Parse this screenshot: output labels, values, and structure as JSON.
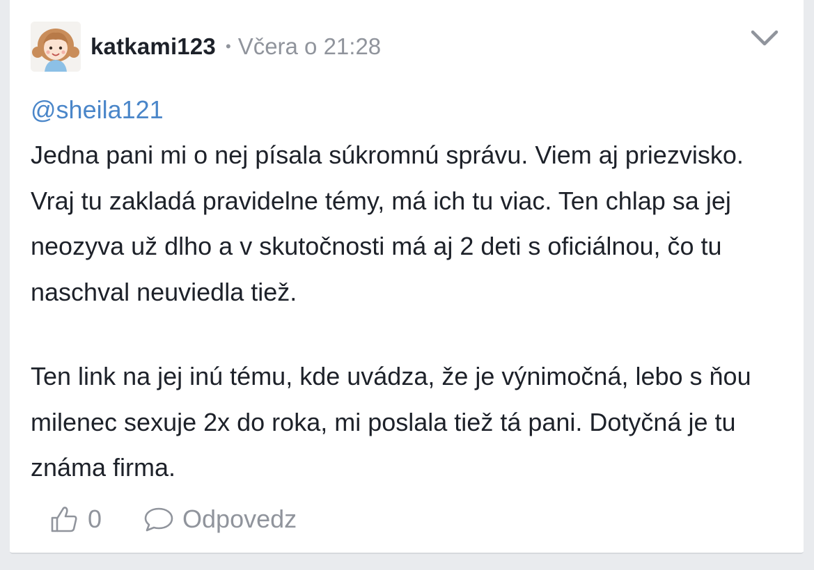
{
  "post": {
    "author": "katkami123",
    "separator": "•",
    "time": "Včera o 21:28",
    "mention": "@sheila121",
    "paragraph1": "Jedna pani mi o nej písala súkromnú správu. Viem aj priezvisko. Vraj tu zakladá pravidelne témy, má ich tu viac. Ten chlap sa jej neozyva už dlho a v skutočnosti má aj 2 deti s oficiálnou, čo tu naschval neuviedla tiež.",
    "paragraph2": "Ten link na jej inú tému, kde uvádza, že je výnimočná, lebo s ňou milenec sexuje 2x do roka, mi poslala tiež tá pani. Dotyčná je tu známa firma."
  },
  "actions": {
    "like_count": "0",
    "reply_label": "Odpovedz"
  },
  "icons": {
    "avatar": "girl-avatar-icon",
    "menu": "chevron-down-icon",
    "like": "thumbs-up-icon",
    "reply": "speech-bubble-icon"
  },
  "colors": {
    "mention": "#4a86c9",
    "muted": "#90949c",
    "text": "#1d2129",
    "background": "#e9ebee"
  }
}
